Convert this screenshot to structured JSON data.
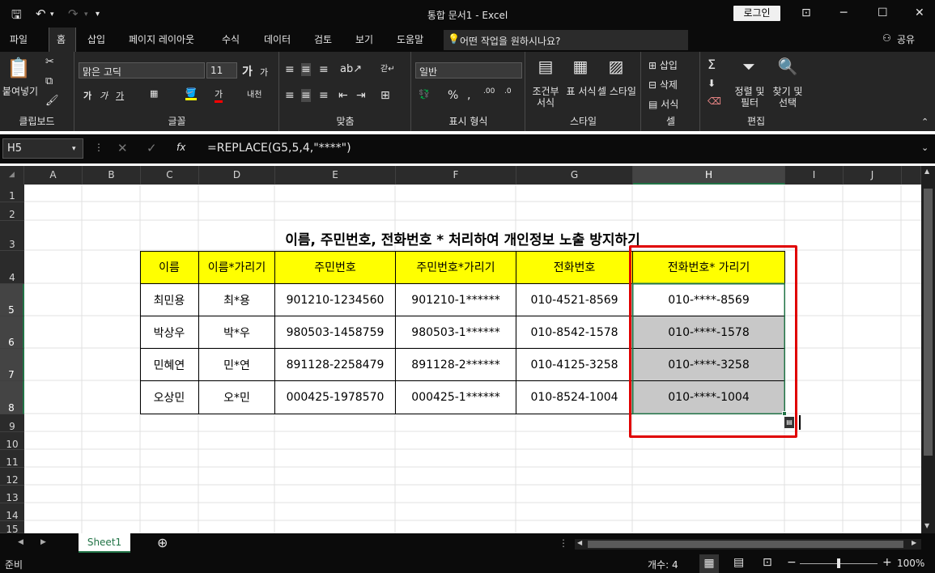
{
  "window": {
    "title": "통합 문서1 - Excel",
    "login_label": "로그인"
  },
  "menu": {
    "tabs": [
      "파일",
      "홈",
      "삽입",
      "페이지 레이아웃",
      "수식",
      "데이터",
      "검토",
      "보기",
      "도움말"
    ],
    "tellme": "어떤 작업을 원하시나요?",
    "share": "공유"
  },
  "ribbon": {
    "paste": "붙여넣기",
    "clipboard": "클립보드",
    "font_name": "맑은 고딕",
    "font_size": "11",
    "font_group": "글꼴",
    "align_group": "맞춤",
    "number_format": "일반",
    "number_group": "표시 형식",
    "cond_format": "조건부 서식",
    "table_format": "표 서식",
    "cell_style": "셀 스타일",
    "style_group": "스타일",
    "insert": "삽입",
    "delete": "삭제",
    "format": "서식",
    "cells_group": "셀",
    "sort_filter": "정렬 및 필터",
    "find_select": "찾기 및 선택",
    "edit_group": "편집"
  },
  "formula_bar": {
    "name_box": "H5",
    "formula": "=REPLACE(G5,5,4,\"****\")"
  },
  "columns": [
    "A",
    "B",
    "C",
    "D",
    "E",
    "F",
    "G",
    "H",
    "I",
    "J"
  ],
  "rows": [
    "1",
    "2",
    "3",
    "4",
    "5",
    "6",
    "7",
    "8",
    "9",
    "10",
    "11",
    "12",
    "13",
    "14",
    "15"
  ],
  "sheet": {
    "title": "이름, 주민번호, 전화번호 * 처리하여 개인정보 노출 방지하기",
    "headers": [
      "이름",
      "이름*가리기",
      "주민번호",
      "주민번호*가리기",
      "전화번호",
      "전화번호* 가리기"
    ],
    "data": [
      [
        "최민용",
        "최*용",
        "901210-1234560",
        "901210-1******",
        "010-4521-8569",
        "010-****-8569"
      ],
      [
        "박상우",
        "박*우",
        "980503-1458759",
        "980503-1******",
        "010-8542-1578",
        "010-****-1578"
      ],
      [
        "민혜연",
        "민*연",
        "891128-2258479",
        "891128-2******",
        "010-4125-3258",
        "010-****-3258"
      ],
      [
        "오상민",
        "오*민",
        "000425-1978570",
        "000425-1******",
        "010-8524-1004",
        "010-****-1004"
      ]
    ]
  },
  "sheet_tab": "Sheet1",
  "status": {
    "ready": "준비",
    "count": "개수: 4",
    "zoom": "100%"
  },
  "colors": {
    "header_fill": "#ffff00",
    "selection_fill": "#c8c8c8",
    "highlight_box": "#e00000"
  }
}
